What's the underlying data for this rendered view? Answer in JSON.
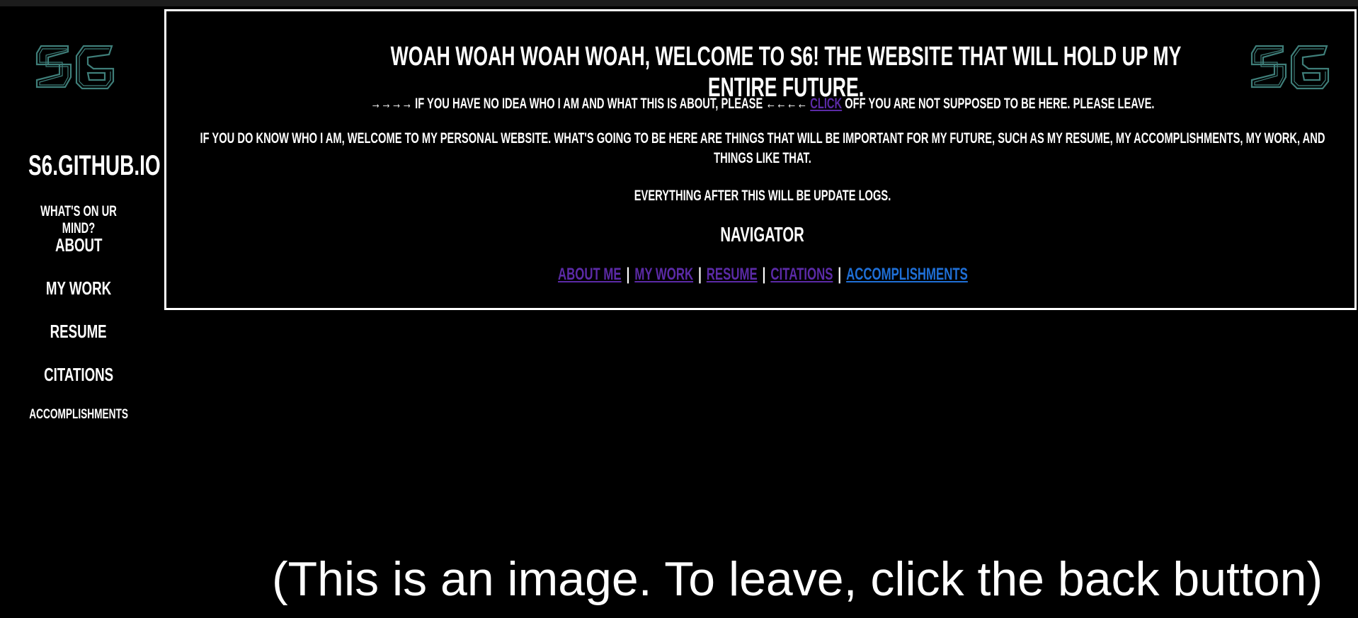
{
  "sidebar": {
    "logo": "S6",
    "site_title": "S6.GITHUB.IO",
    "subtitle": "WHAT'S ON UR MIND?",
    "links": [
      "ABOUT",
      "MY WORK",
      "RESUME",
      "CITATIONS",
      "ACCOMPLISHMENTS"
    ]
  },
  "main": {
    "headline": "WOAH WOAH WOAH WOAH, WELCOME TO S6! THE WEBSITE THAT WILL HOLD UP MY ENTIRE FUTURE.",
    "logo": "S6",
    "intro_before": "→→→→ IF YOU HAVE NO IDEA WHO I AM AND WHAT THIS IS ABOUT, PLEASE ←←←←",
    "intro_link": "CLICK",
    "intro_after": "OFF YOU ARE NOT SUPPOSED TO BE HERE. PLEASE LEAVE.",
    "paragraph": "IF YOU DO KNOW WHO I AM, WELCOME TO MY PERSONAL WEBSITE. WHAT'S GOING TO BE HERE ARE THINGS THAT WILL BE IMPORTANT FOR MY FUTURE, SUCH AS MY RESUME, MY ACCOMPLISHMENTS, MY WORK, AND THINGS LIKE THAT.",
    "update_note": "EVERYTHING AFTER THIS WILL BE UPDATE LOGS.",
    "navigator_title": "NAVIGATOR",
    "nav_links": [
      "ABOUT ME",
      "MY WORK",
      "RESUME",
      "CITATIONS",
      "ACCOMPLISHMENTS"
    ],
    "separator": "|"
  },
  "caption": "(This is an image. To leave, click the back button)",
  "colors": {
    "background": "#000000",
    "text": "#ffffff",
    "link_visited": "#5b2aa6",
    "link": "#1f6fd6",
    "logo_stroke": "#3f7f7a"
  }
}
